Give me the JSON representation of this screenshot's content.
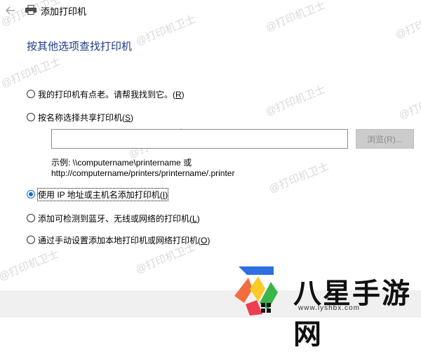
{
  "window": {
    "title": "添加打印机"
  },
  "heading": "按其他选项查找打印机",
  "options": [
    {
      "text": "我的打印机有点老。请帮我找到它。(",
      "key": "R",
      "tail": ")",
      "selected": false
    },
    {
      "text": "按名称选择共享打印机(",
      "key": "S",
      "tail": ")",
      "selected": false
    },
    {
      "text": "使用 IP 地址或主机名添加打印机(",
      "key": "I",
      "tail": ")",
      "selected": true
    },
    {
      "text": "添加可检测到蓝牙、无线或网络的打印机(",
      "key": "L",
      "tail": ")",
      "selected": false
    },
    {
      "text": "通过手动设置添加本地打印机或网络打印机(",
      "key": "O",
      "tail": ")",
      "selected": false
    }
  ],
  "share_input": {
    "value": ""
  },
  "browse_button": "浏览(R)...",
  "example_line1": "示例: \\\\computername\\printername 或",
  "example_line2": "http://computername/printers/printername/.printer",
  "watermark": "@打印机卫士",
  "site_logo": {
    "name": "八星手游网",
    "url": "www.lyshbx.com"
  },
  "colors": {
    "heading": "#1e3a8a",
    "radio_selected": "#1a67d6",
    "button_disabled_bg": "#cccccc"
  }
}
